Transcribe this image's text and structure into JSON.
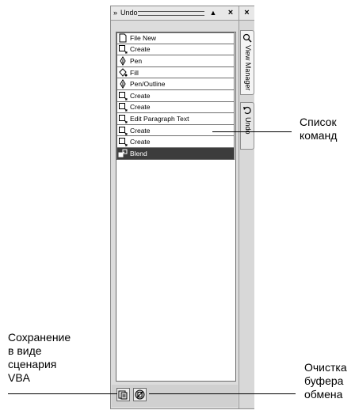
{
  "docker": {
    "title": "Undo",
    "up_label": "▲",
    "close_label": "×",
    "outer_close_label": "×"
  },
  "side_tabs": [
    {
      "label": "View Manager",
      "icon": "magnifier-icon"
    },
    {
      "label": "Undo",
      "icon": "undo-icon"
    }
  ],
  "undo_list": [
    {
      "label": "File New",
      "icon": "document-icon",
      "selected": false
    },
    {
      "label": "Create",
      "icon": "rectangle-tool-icon",
      "selected": false
    },
    {
      "label": "Pen",
      "icon": "pen-icon",
      "selected": false
    },
    {
      "label": "Fill",
      "icon": "fill-bucket-icon",
      "selected": false
    },
    {
      "label": "Pen/Outline",
      "icon": "pen-icon",
      "selected": false
    },
    {
      "label": "Create",
      "icon": "rectangle-tool-icon",
      "selected": false
    },
    {
      "label": "Create",
      "icon": "rectangle-tool-icon",
      "selected": false
    },
    {
      "label": "Edit Paragraph Text",
      "icon": "rectangle-tool-icon",
      "selected": false
    },
    {
      "label": "Create",
      "icon": "rectangle-tool-icon",
      "selected": false
    },
    {
      "label": "Create",
      "icon": "rectangle-tool-icon",
      "selected": false
    },
    {
      "label": "Blend",
      "icon": "blend-icon",
      "selected": true
    }
  ],
  "bottom_buttons": [
    {
      "name": "save-as-vba-script-button",
      "icon": "save-script-icon"
    },
    {
      "name": "clear-clipboard-button",
      "icon": "clear-clipboard-icon"
    }
  ],
  "callouts": {
    "commands": [
      "Список",
      "команд"
    ],
    "vba": [
      "Сохранение",
      "в виде",
      "сценария",
      "VBA"
    ],
    "clear": [
      "Очистка",
      "буфера",
      "обмена"
    ]
  },
  "colors": {
    "selected_row_bg": "#3c3c3c",
    "panel_bg": "#dcdcdc"
  }
}
